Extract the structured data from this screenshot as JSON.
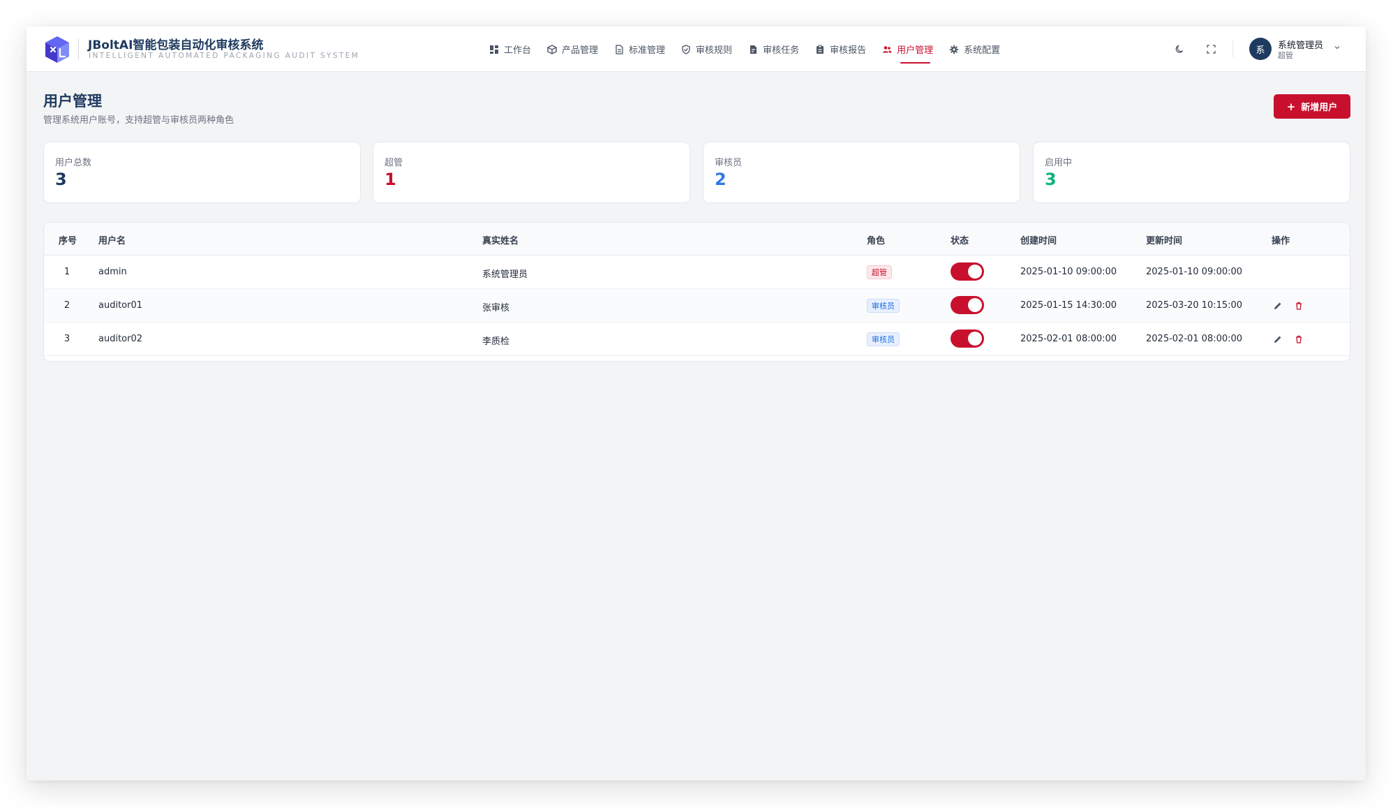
{
  "brand": {
    "title": "JBoltAI智能包装自动化审核系统",
    "subtitle": "INTELLIGENT AUTOMATED PACKAGING AUDIT SYSTEM"
  },
  "nav": [
    {
      "label": "工作台",
      "icon": "dashboard-icon"
    },
    {
      "label": "产品管理",
      "icon": "box-icon"
    },
    {
      "label": "标准管理",
      "icon": "document-icon"
    },
    {
      "label": "审核规则",
      "icon": "shield-check-icon"
    },
    {
      "label": "审核任务",
      "icon": "file-task-icon"
    },
    {
      "label": "审核报告",
      "icon": "clipboard-icon"
    },
    {
      "label": "用户管理",
      "icon": "users-icon",
      "active": true
    },
    {
      "label": "系统配置",
      "icon": "gear-icon"
    }
  ],
  "user": {
    "avatar_text": "系",
    "name": "系统管理员",
    "role": "超管"
  },
  "page": {
    "title": "用户管理",
    "description": "管理系统用户账号，支持超管与审核员两种角色",
    "add_button": "新增用户"
  },
  "stats": [
    {
      "label": "用户总数",
      "value": "3",
      "color": "#1e3a5f"
    },
    {
      "label": "超管",
      "value": "1",
      "color": "#c8102e"
    },
    {
      "label": "审核员",
      "value": "2",
      "color": "#2f7be5"
    },
    {
      "label": "启用中",
      "value": "3",
      "color": "#10b37e"
    }
  ],
  "table": {
    "headers": {
      "index": "序号",
      "username": "用户名",
      "realname": "真实姓名",
      "role": "角色",
      "status": "状态",
      "created": "创建时间",
      "updated": "更新时间",
      "actions": "操作"
    },
    "rows": [
      {
        "index": "1",
        "username": "admin",
        "realname": "系统管理员",
        "role": "超管",
        "role_type": "super",
        "enabled": true,
        "created": "2025-01-10 09:00:00",
        "updated": "2025-01-10 09:00:00",
        "editable": false
      },
      {
        "index": "2",
        "username": "auditor01",
        "realname": "张审核",
        "role": "审核员",
        "role_type": "auditor",
        "enabled": true,
        "created": "2025-01-15 14:30:00",
        "updated": "2025-03-20 10:15:00",
        "editable": true
      },
      {
        "index": "3",
        "username": "auditor02",
        "realname": "李质检",
        "role": "审核员",
        "role_type": "auditor",
        "enabled": true,
        "created": "2025-02-01 08:00:00",
        "updated": "2025-02-01 08:00:00",
        "editable": true
      }
    ]
  },
  "colors": {
    "accent": "#c8102e",
    "navy": "#1e3a5f"
  }
}
